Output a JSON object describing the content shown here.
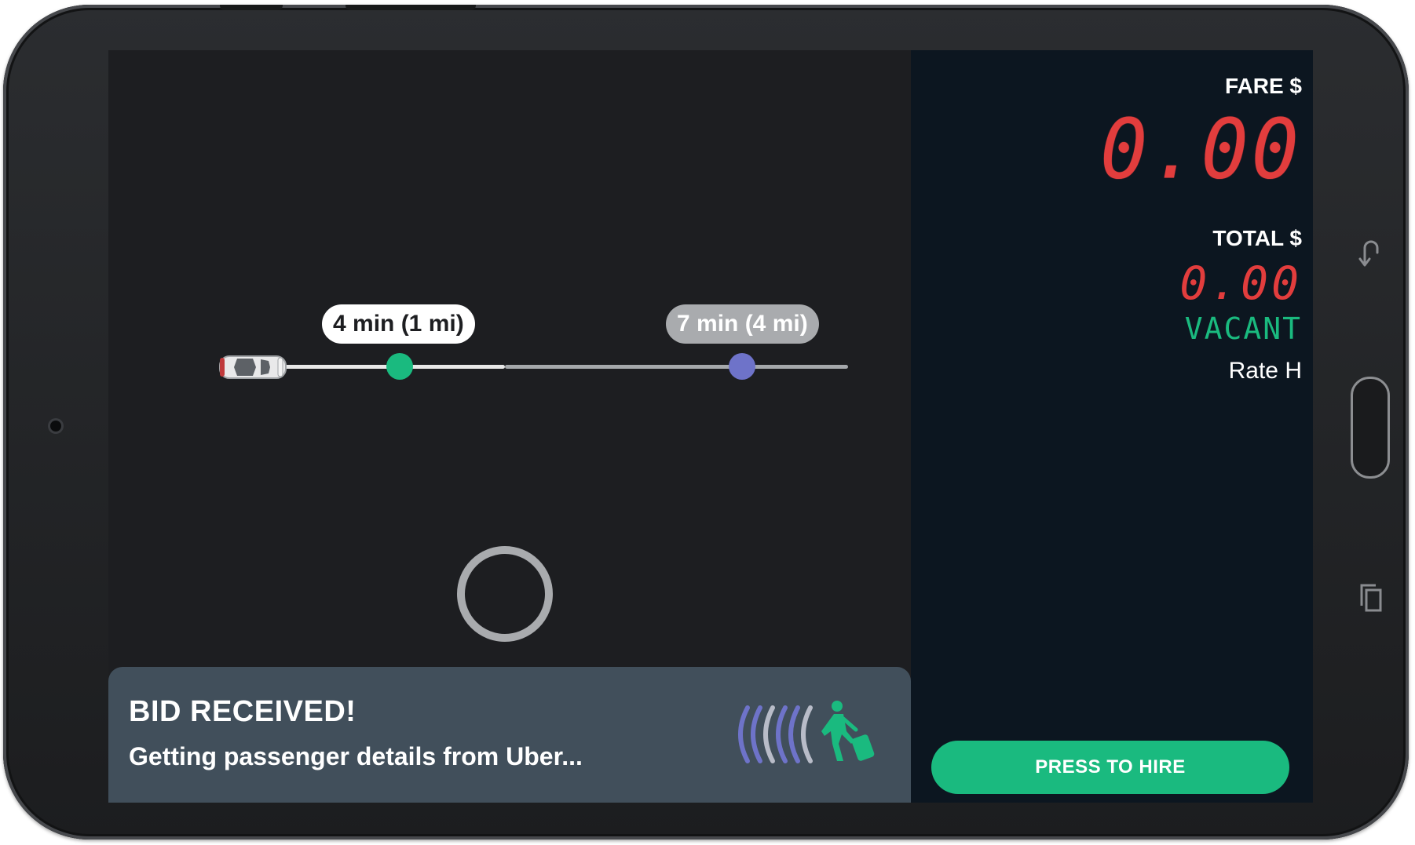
{
  "device": {
    "type": "android-tablet"
  },
  "map": {
    "pickup_eta": "4 min (1 mi)",
    "dropoff_eta": "7 min (4 mi)"
  },
  "bid_banner": {
    "title": "BID RECEIVED!",
    "subtitle": "Getting passenger details from Uber..."
  },
  "meter": {
    "fare_label": "FARE $",
    "fare_value": "0.00",
    "total_label": "TOTAL $",
    "total_value": "0.00",
    "status": "VACANT",
    "rate": "Rate H"
  },
  "actions": {
    "hire_label": "PRESS TO HIRE"
  },
  "colors": {
    "accent_green": "#1aba7f",
    "led_red": "#e23d3d",
    "dropoff_purple": "#6e73c9",
    "panel_bg": "#0c1620",
    "banner_bg": "#414f5b"
  },
  "icons": {
    "car": "car-icon",
    "pickup": "pickup-dot-icon",
    "dropoff": "dropoff-dot-icon",
    "loader": "loading-ring-icon",
    "signal": "signal-waves-icon",
    "passenger": "passenger-walking-luggage-icon",
    "nav_back": "back-icon",
    "nav_recent": "recent-apps-icon"
  }
}
